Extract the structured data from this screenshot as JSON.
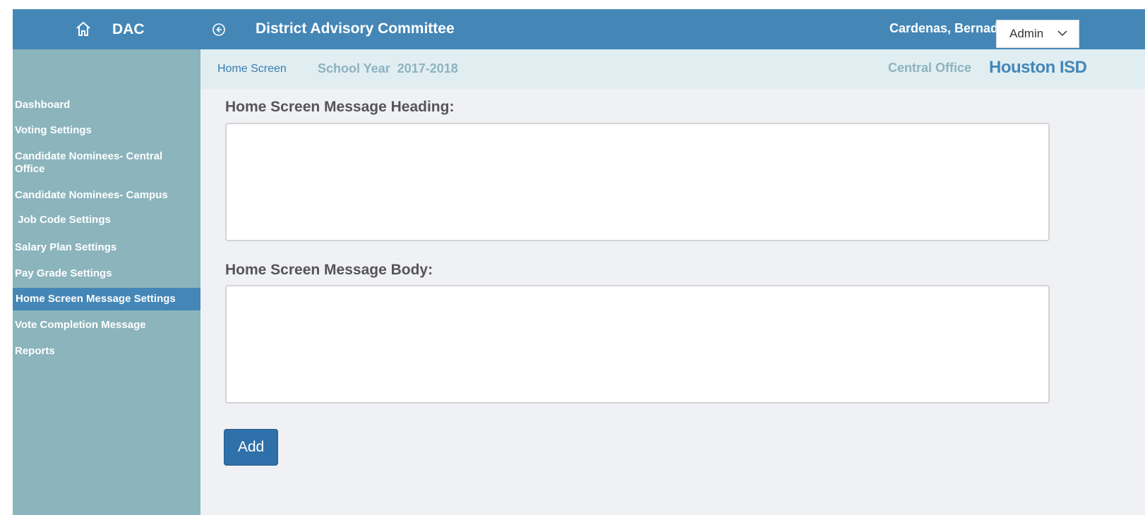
{
  "header": {
    "app_short": "DAC",
    "title": "District Advisory Committee",
    "user_name": "Cardenas, Bernadette",
    "role_selected": "Admin",
    "icons": {
      "home": "home-icon",
      "back": "back-circle-icon",
      "dropdown": "chevron-down-icon"
    }
  },
  "subheader": {
    "breadcrumb": "Home Screen",
    "school_year": "School Year  2017-2018",
    "office": "Central Office",
    "brand": "Houston ISD"
  },
  "sidebar": {
    "items": [
      {
        "label": "Dashboard"
      },
      {
        "label": "Voting Settings"
      },
      {
        "label": "Candidate Nominees- Central Office"
      },
      {
        "label": "Candidate Nominees- Campus"
      },
      {
        "label": " Job Code Settings"
      },
      {
        "label": "Salary Plan Settings"
      },
      {
        "label": "Pay Grade Settings"
      },
      {
        "label": "Home Screen Message Settings",
        "active": true
      },
      {
        "label": "Vote Completion Message"
      },
      {
        "label": "Reports"
      }
    ]
  },
  "form": {
    "heading_label": "Home Screen Message Heading:",
    "heading_value": "",
    "body_label": "Home Screen Message Body:",
    "body_value": "",
    "submit_label": "Add"
  },
  "colors": {
    "header_bg": "#4487b7",
    "sidebar_bg": "#8bb4bd",
    "subheader_bg": "#e1eef1",
    "content_bg": "#f0f1f5",
    "button_bg": "#2e70aa"
  }
}
